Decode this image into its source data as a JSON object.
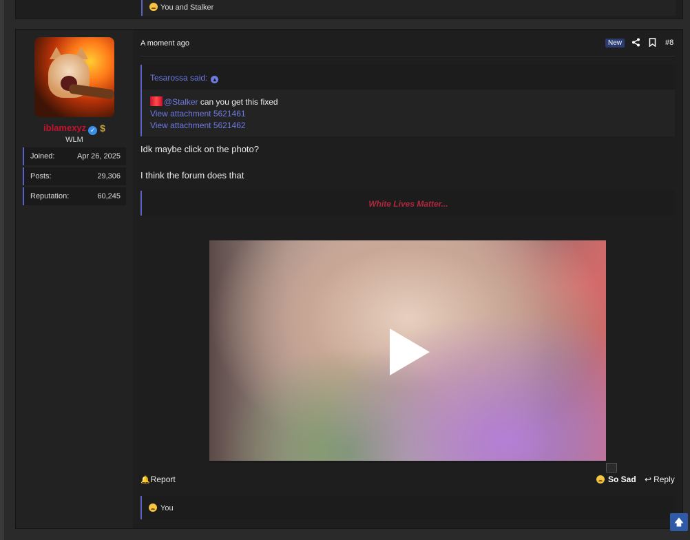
{
  "previous_post": {
    "reactions_text": "You and Stalker"
  },
  "post": {
    "user": {
      "username": "iblamexyz",
      "user_title": "WLM",
      "stats": [
        {
          "label": "Joined:",
          "value": "Apr 26, 2025"
        },
        {
          "label": "Posts:",
          "value": "29,306"
        },
        {
          "label": "Reputation:",
          "value": "60,245"
        }
      ]
    },
    "timestamp": "A moment ago",
    "new_badge": "New",
    "post_number": "#8",
    "quote": {
      "author_said": "Tesarossa said:",
      "mention": "@Stalker",
      "text": " can you get this fixed",
      "links": [
        "View attachment 5621461",
        "View attachment 5621462"
      ]
    },
    "body": [
      "Idk maybe click on the photo?",
      "I think the forum does that"
    ],
    "signature": "White Lives Matter...",
    "actions": {
      "report": "Report",
      "reaction": "So Sad",
      "reply": "Reply"
    },
    "reactions_text": "You"
  },
  "icons": {
    "share": "share-icon",
    "bookmark": "bookmark-icon",
    "play": "play-icon",
    "scroll_top": "arrow-up-icon"
  },
  "colors": {
    "accent": "#5c63c7",
    "username": "#c8102e",
    "signature": "#b0283c",
    "link": "#6f7ae0"
  }
}
